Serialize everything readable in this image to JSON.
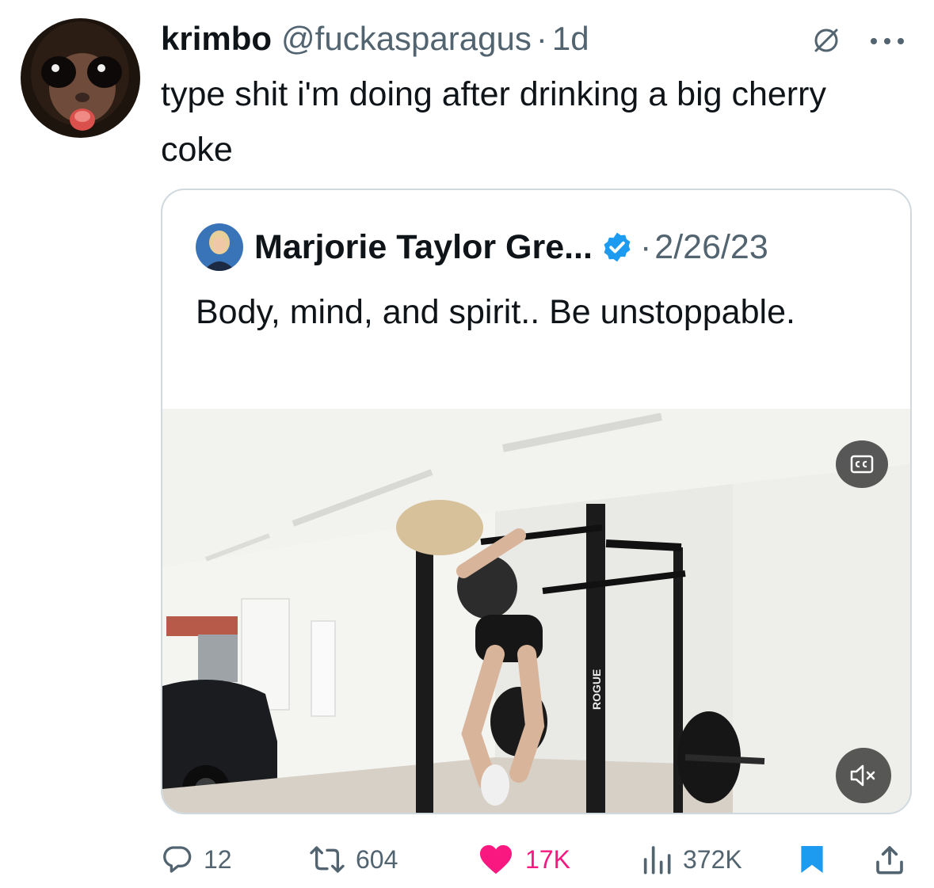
{
  "tweet": {
    "display_name": "krimbo",
    "handle": "@fuckasparagus",
    "separator": "·",
    "time": "1d",
    "text": "type shit i'm doing after drinking a  big cherry coke"
  },
  "quoted": {
    "display_name": "Marjorie Taylor Gre...",
    "separator": "·",
    "date": "2/26/23",
    "text": "Body, mind, and spirit.. Be unstoppable.",
    "video_logo": "ROGUE"
  },
  "actions": {
    "replies": "12",
    "reposts": "604",
    "likes": "17K",
    "views": "372K"
  },
  "colors": {
    "secondary_text": "#536471",
    "like_pink": "#f91880",
    "verified_blue": "#1d9bf0",
    "bookmark_blue": "#1d9bf0",
    "border": "#cfd9de"
  },
  "icons": [
    "grok-icon",
    "more-icon",
    "verified-badge-icon",
    "closed-captions-icon",
    "muted-speaker-icon",
    "reply-icon",
    "repost-icon",
    "like-heart-icon",
    "views-icon",
    "bookmark-icon",
    "share-icon"
  ]
}
